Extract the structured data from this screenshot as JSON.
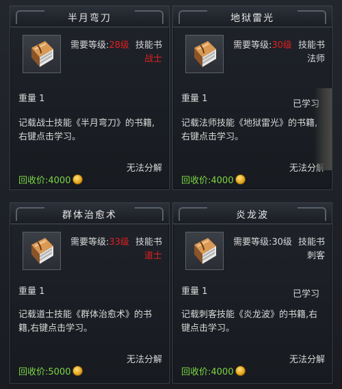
{
  "cards": [
    {
      "title": "半月弯刀",
      "req_label": "需要等级:",
      "req_level": "28级",
      "req_level_red": true,
      "type": "技能书",
      "class": "战士",
      "class_red": true,
      "weight": "重量 1",
      "learned": "",
      "desc": "记载战士技能《半月弯刀》的书籍,右键点击学习。",
      "no_disassemble": "无法分解",
      "price_label": "回收价:4000",
      "price": 4000
    },
    {
      "title": "地狱雷光",
      "req_label": "需要等级:",
      "req_level": "30级",
      "req_level_red": true,
      "type": "技能书",
      "class": "法师",
      "class_red": false,
      "weight": "重量 1",
      "learned": "已学习",
      "desc": "记载法师技能《地狱雷光》的书籍,右键点击学习。",
      "no_disassemble": "无法分解",
      "price_label": "回收价:4000",
      "price": 4000
    },
    {
      "title": "群体治愈术",
      "req_label": "需要等级:",
      "req_level": "33级",
      "req_level_red": true,
      "type": "技能书",
      "class": "道士",
      "class_red": true,
      "weight": "重量 1",
      "learned": "",
      "desc": "记载道士技能《群体治愈术》的书籍,右键点击学习。",
      "no_disassemble": "无法分解",
      "price_label": "回收价:5000",
      "price": 5000
    },
    {
      "title": "炎龙波",
      "req_label": "需要等级:",
      "req_level": "30级",
      "req_level_red": false,
      "type": "技能书",
      "class": "刺客",
      "class_red": false,
      "weight": "重量 1",
      "learned": "已学习",
      "desc": "记载刺客技能《炎龙波》的书籍,右键点击学习。",
      "no_disassemble": "无法分解",
      "price_label": "回收价:4000",
      "price": 4000
    }
  ],
  "icons": {
    "item": "skill-book-icon",
    "currency": "gold-coin-icon"
  },
  "colors": {
    "red": "#e02020",
    "price_green": "#7cd846",
    "text": "#d8d8d8"
  }
}
